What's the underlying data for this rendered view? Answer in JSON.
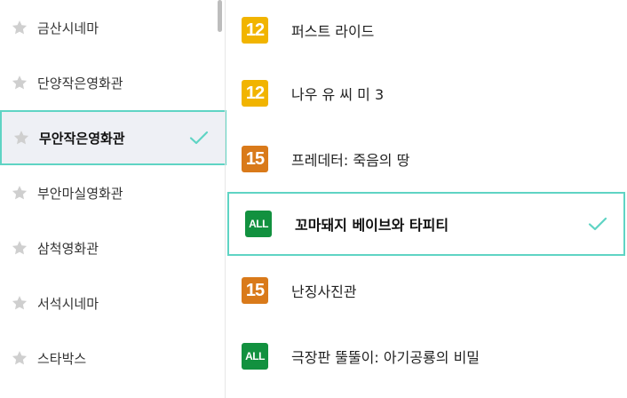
{
  "theaters": [
    {
      "name": "금산시네마",
      "selected": false
    },
    {
      "name": "단양작은영화관",
      "selected": false
    },
    {
      "name": "무안작은영화관",
      "selected": true
    },
    {
      "name": "부안마실영화관",
      "selected": false
    },
    {
      "name": "삼척영화관",
      "selected": false
    },
    {
      "name": "서석시네마",
      "selected": false
    },
    {
      "name": "스타박스",
      "selected": false
    }
  ],
  "movies": [
    {
      "title": "퍼스트 라이드",
      "rating": "12",
      "selected": false
    },
    {
      "title": "나우 유 씨 미 3",
      "rating": "12",
      "selected": false
    },
    {
      "title": "프레데터: 죽음의 땅",
      "rating": "15",
      "selected": false
    },
    {
      "title": "꼬마돼지 베이브와 타피티",
      "rating": "ALL",
      "selected": true
    },
    {
      "title": "난징사진관",
      "rating": "15",
      "selected": false
    },
    {
      "title": "극장판 뚤뚤이: 아기공룡의 비밀",
      "rating": "ALL",
      "selected": false
    }
  ],
  "colors": {
    "accent": "#5fd4c4",
    "selected_bg": "#eef0f5",
    "rating_12": "#f1b400",
    "rating_15": "#d97a1a",
    "rating_all": "#12913f",
    "star": "#cfcfcf"
  },
  "icons": {
    "favorite": "star-icon",
    "selected": "check-icon"
  }
}
